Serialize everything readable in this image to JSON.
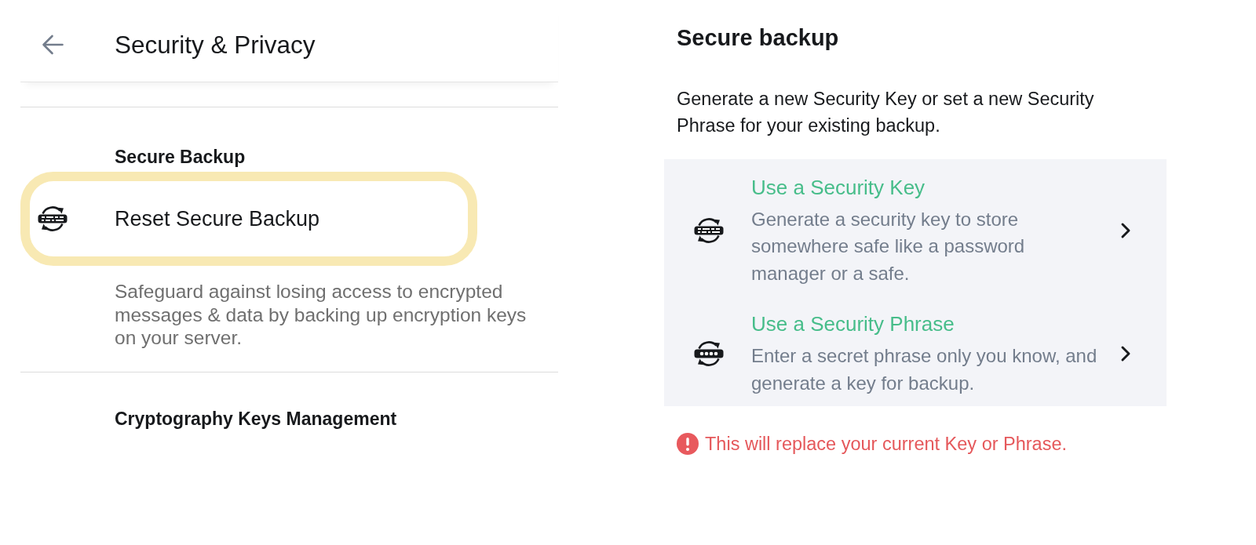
{
  "settings_screen": {
    "title": "Security & Privacy",
    "sections": [
      {
        "heading": "Secure Backup",
        "items": [
          {
            "label": "Reset Secure Backup",
            "highlighted": true
          }
        ],
        "summary": "Safeguard against losing access to encrypted messages & data by backing up encryption keys on your server."
      },
      {
        "heading": "Cryptography Keys Management"
      }
    ]
  },
  "secure_backup_screen": {
    "title": "Secure backup",
    "description": "Generate a new Security Key or set a new Security Phrase for your existing backup.",
    "options": [
      {
        "kind": "key",
        "title": "Use a Security Key",
        "description": "Generate a security key to store somewhere safe like a password manager or a safe."
      },
      {
        "kind": "phrase",
        "title": "Use a Security Phrase",
        "description": "Enter a secret phrase only you know, and generate a key for backup."
      }
    ],
    "warning": "This will replace your current Key or Phrase."
  }
}
